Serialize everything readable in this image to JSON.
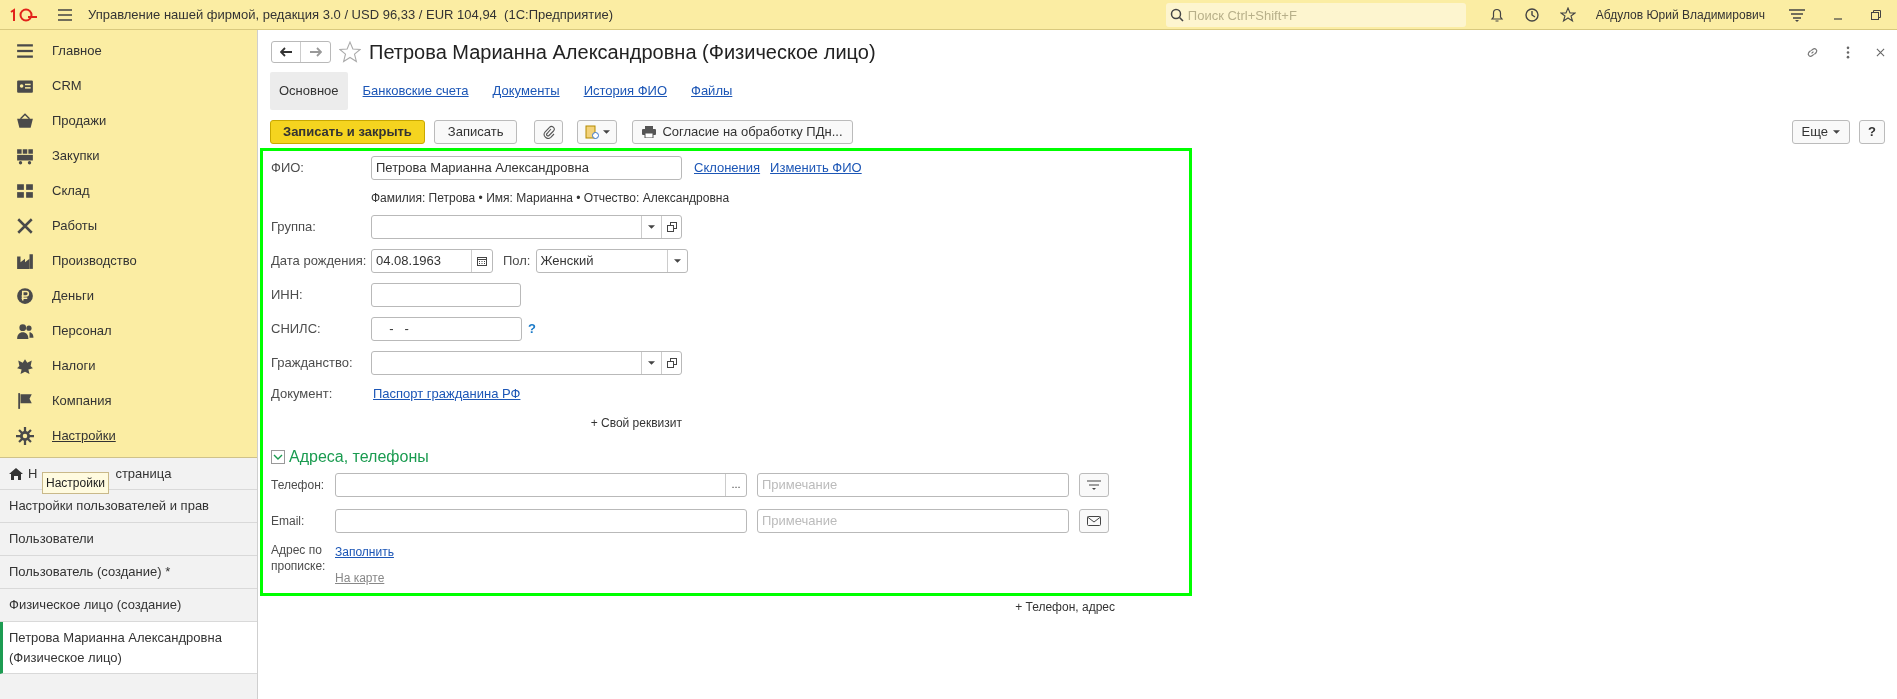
{
  "app_bar": {
    "title": "Управление нашей фирмой, редакция 3.0 / USD 96,33 / EUR 104,94  (1С:Предприятие)",
    "search": {
      "placeholder": "Поиск Ctrl+Shift+F"
    },
    "user": "Абдулов Юрий Владимирович"
  },
  "sections": [
    {
      "label": "Главное",
      "hovered": false
    },
    {
      "label": "CRM",
      "hovered": false
    },
    {
      "label": "Продажи",
      "hovered": false
    },
    {
      "label": "Закупки",
      "hovered": false
    },
    {
      "label": "Склад",
      "hovered": false
    },
    {
      "label": "Работы",
      "hovered": false
    },
    {
      "label": "Производство",
      "hovered": false
    },
    {
      "label": "Деньги",
      "hovered": false
    },
    {
      "label": "Персонал",
      "hovered": false
    },
    {
      "label": "Налоги",
      "hovered": false
    },
    {
      "label": "Компания",
      "hovered": false
    },
    {
      "label": "Настройки",
      "hovered": true
    }
  ],
  "home": {
    "label_start": "Н",
    "label_end": "страница"
  },
  "tooltip": "Настройки",
  "windows": [
    {
      "label": "Настройки пользователей и прав",
      "selected": false
    },
    {
      "label": "Пользователи",
      "selected": false
    },
    {
      "label": "Пользователь (создание) *",
      "selected": false
    },
    {
      "label": "Физическое лицо (создание)",
      "selected": false
    },
    {
      "label": "Петрова Марианна Александровна (Физическое лицо)",
      "selected": true
    }
  ],
  "form": {
    "title": "Петрова Марианна Александровна (Физическое лицо)",
    "tabs": [
      {
        "label": "Основное",
        "selected": true
      },
      {
        "label": "Банковские счета",
        "selected": false
      },
      {
        "label": "Документы",
        "selected": false
      },
      {
        "label": "История ФИО",
        "selected": false
      },
      {
        "label": "Файлы",
        "selected": false
      }
    ],
    "toolbar": {
      "save_close": "Записать и закрыть",
      "save": "Записать",
      "consent": "Согласие на обработку ПДн...",
      "more": "Еще",
      "help": "?"
    },
    "fio": {
      "label": "ФИО:",
      "value": "Петрова Марианна Александровна",
      "links": [
        "Склонения",
        "Изменить ФИО"
      ],
      "parts": "Фамилия: Петрова • Имя: Марианна • Отчество: Александровна"
    },
    "group": {
      "label": "Группа:"
    },
    "birth": {
      "label": "Дата рождения:",
      "value": "04.08.1963"
    },
    "sex": {
      "label": "Пол:",
      "value": "Женский"
    },
    "inn": {
      "label": "ИНН:"
    },
    "snils": {
      "label": "СНИЛС:",
      "value": "  -   -",
      "help": "?"
    },
    "citizenship": {
      "label": "Гражданство:"
    },
    "document": {
      "label": "Документ:",
      "link": "Паспорт гражданина РФ"
    },
    "custom_attr": "+ Свой реквизит",
    "contacts": {
      "title": "Адреса, телефоны",
      "expanded": true,
      "phone": {
        "label": "Телефон:",
        "more": "...",
        "note_placeholder": "Примечание"
      },
      "email": {
        "label": "Email:",
        "note_placeholder": "Примечание"
      },
      "address": {
        "label": "Адрес по прописке:",
        "fill_link": "Заполнить",
        "map_link": "На карте"
      }
    },
    "add_contact": "+ Телефон, адрес"
  }
}
